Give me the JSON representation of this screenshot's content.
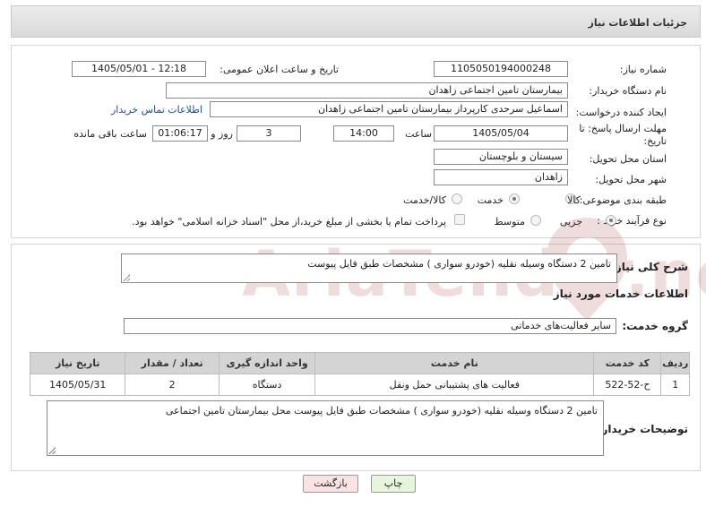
{
  "header": {
    "title": "جزئیات اطلاعات نیاز"
  },
  "form": {
    "need_number_label": "شماره نیاز:",
    "need_number": "1105050194000248",
    "announce_label": "تاریخ و ساعت اعلان عمومی:",
    "announce_value": "1405/05/01 - 12:18",
    "buyer_org_label": "نام دستگاه خریدار:",
    "buyer_org": "بیمارستان تامین اجتماعی زاهدان",
    "creator_label": "ایجاد کننده درخواست:",
    "creator": "اسماعیل سرحدی کارپرداز بیمارستان تامین اجتماعی زاهدان",
    "contact_link": "اطلاعات تماس خریدار",
    "deadline_label_1": "مهلت ارسال پاسخ: تا",
    "deadline_label_2": "تاریخ:",
    "deadline_date": "1405/05/04",
    "time_label": "ساعت",
    "deadline_time": "14:00",
    "days_value": "3",
    "days_label": "روز و",
    "remaining_value": "01:06:17",
    "remaining_label": "ساعت باقی مانده",
    "province_label": "استان محل تحویل:",
    "province": "سیستان و بلوچستان",
    "city_label": "شهر محل تحویل:",
    "city": "زاهدان",
    "category_label": "طبقه بندی موضوعی:",
    "category_options": [
      "کالا",
      "خدمت",
      "کالا/خدمت"
    ],
    "purchase_label": "نوع فرآیند خرید :",
    "purchase_options": [
      "جزیی",
      "متوسط"
    ],
    "payment_note": "پرداخت تمام یا بخشی از مبلغ خرید،از محل \"اسناد خزانه اسلامی\" خواهد بود."
  },
  "general": {
    "summary_label": "شرح کلی نیاز:",
    "summary": "تامین 2 دستگاه وسیله نقلیه (خودرو سواری ) مشخصات طبق فایل پیوست",
    "services_heading": "اطلاعات خدمات مورد نیاز",
    "group_label": "گروه خدمت:",
    "group": "سایر فعالیت‌های خدماتی"
  },
  "table": {
    "headers": [
      "ردیف",
      "کد خدمت",
      "نام خدمت",
      "واحد اندازه گیری",
      "تعداد / مقدار",
      "تاریخ نیاز"
    ],
    "rows": [
      [
        "1",
        "ح-52-522",
        "فعالیت های پشتیبانی حمل ونقل",
        "دستگاه",
        "2",
        "1405/05/31"
      ]
    ]
  },
  "buyer_notes": {
    "label": "توضیحات خریدار:",
    "text": "تامین 2 دستگاه وسیله نقلیه (خودرو سواری ) مشخصات طبق فایل پیوست محل بیمارستان تامین اجتماعی"
  },
  "buttons": {
    "print": "چاپ",
    "back": "بازگشت"
  },
  "watermark": {
    "text": "AriaTender.neT"
  },
  "colors": {
    "link": "#1a4f9c",
    "print_bg": "#e6f5dc",
    "back_bg": "#fbe3e3"
  }
}
